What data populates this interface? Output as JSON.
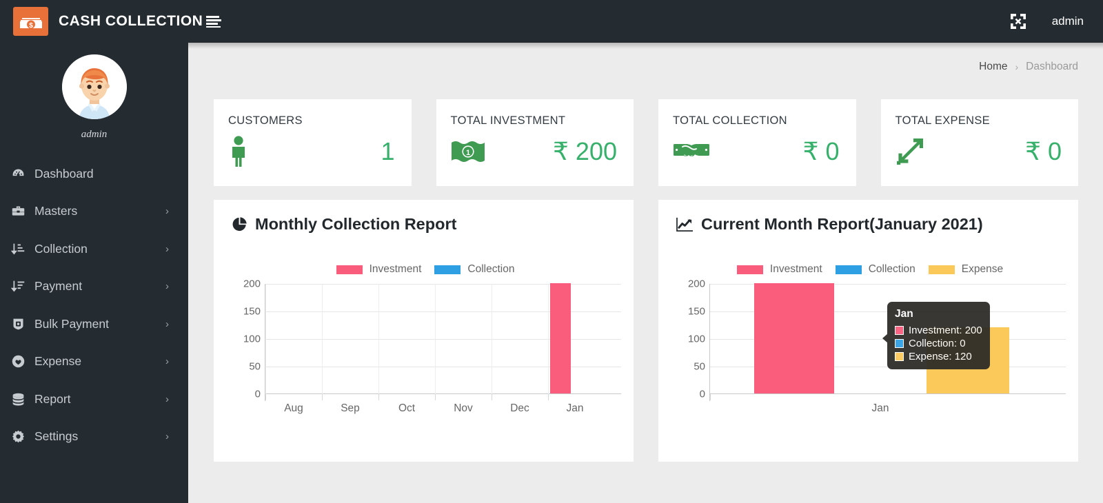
{
  "navbar": {
    "brand_title": "CASH COLLECTION",
    "logo_icon": "money-stack-icon",
    "menu_toggle_icon": "hamburger-icon",
    "fullscreen_icon": "expand-arrows-icon",
    "user_label": "admin"
  },
  "sidebar": {
    "profile": {
      "avatar_icon": "user-avatar",
      "name": "admin"
    },
    "items": [
      {
        "label": "Dashboard",
        "icon": "dashboard-icon",
        "has_caret": false,
        "caret": "›"
      },
      {
        "label": "Masters",
        "icon": "briefcase-icon",
        "has_caret": true,
        "caret": "›"
      },
      {
        "label": "Collection",
        "icon": "sort-amount-icon",
        "has_caret": true,
        "caret": "›"
      },
      {
        "label": "Payment",
        "icon": "sort-list-icon",
        "has_caret": true,
        "caret": "›"
      },
      {
        "label": "Bulk Payment",
        "icon": "shield-box-icon",
        "has_caret": true,
        "caret": "›"
      },
      {
        "label": "Expense",
        "icon": "heart-circle-icon",
        "has_caret": true,
        "caret": "›"
      },
      {
        "label": "Report",
        "icon": "database-icon",
        "has_caret": true,
        "caret": "›"
      },
      {
        "label": "Settings",
        "icon": "gear-icon",
        "has_caret": true,
        "caret": "›"
      }
    ]
  },
  "breadcrumb": {
    "home": "Home",
    "separator": "›",
    "current": "Dashboard"
  },
  "stats": [
    {
      "title": "CUSTOMERS",
      "value": "1",
      "icon": "person-icon"
    },
    {
      "title": "TOTAL INVESTMENT",
      "value": "₹ 200",
      "icon": "banknote-icon"
    },
    {
      "title": "TOTAL COLLECTION",
      "value": "₹ 0",
      "icon": "handshake-money-icon"
    },
    {
      "title": "TOTAL EXPENSE",
      "value": "₹ 0",
      "icon": "arrows-expand-icon"
    }
  ],
  "colors": {
    "navbar": "#242c31",
    "sidebar": "#242c31",
    "page_bg": "#ececec",
    "brand_accent": "#e8713a",
    "stat_green": "#36b06a",
    "investment": "#fa5c7c",
    "collection": "#2f9fe3",
    "expense": "#fbc85a",
    "tooltip_bg": "#2c2b28"
  },
  "panels": [
    {
      "title": "Monthly Collection Report",
      "icon": "pie-chart-icon"
    },
    {
      "title": "Current Month Report(January 2021)",
      "icon": "line-chart-icon"
    }
  ],
  "chart_data": [
    {
      "type": "bar",
      "title": "Monthly Collection Report",
      "categories": [
        "Aug",
        "Sep",
        "Oct",
        "Nov",
        "Dec",
        "Jan"
      ],
      "series": [
        {
          "name": "Investment",
          "color": "#fa5c7c",
          "values": [
            0,
            0,
            0,
            0,
            0,
            200
          ]
        },
        {
          "name": "Collection",
          "color": "#2f9fe3",
          "values": [
            0,
            0,
            0,
            0,
            0,
            0
          ]
        }
      ],
      "ylim": [
        0,
        200
      ],
      "yticks": [
        0,
        50,
        100,
        150,
        200
      ],
      "xlabel": "",
      "ylabel": "",
      "grid": true,
      "legend_position": "top"
    },
    {
      "type": "bar",
      "title": "Current Month Report(January 2021)",
      "categories": [
        "Jan"
      ],
      "series": [
        {
          "name": "Investment",
          "color": "#fa5c7c",
          "values": [
            200
          ]
        },
        {
          "name": "Collection",
          "color": "#2f9fe3",
          "values": [
            0
          ]
        },
        {
          "name": "Expense",
          "color": "#fbc85a",
          "values": [
            120
          ]
        }
      ],
      "ylim": [
        0,
        200
      ],
      "yticks": [
        0,
        50,
        100,
        150,
        200
      ],
      "xlabel": "",
      "ylabel": "",
      "grid": true,
      "legend_position": "top",
      "tooltip": {
        "title": "Jan",
        "rows": [
          {
            "label": "Investment: 200",
            "color": "#fa5c7c"
          },
          {
            "label": "Collection: 0",
            "color": "#2f9fe3"
          },
          {
            "label": "Expense: 120",
            "color": "#fbc85a"
          }
        ]
      }
    }
  ]
}
